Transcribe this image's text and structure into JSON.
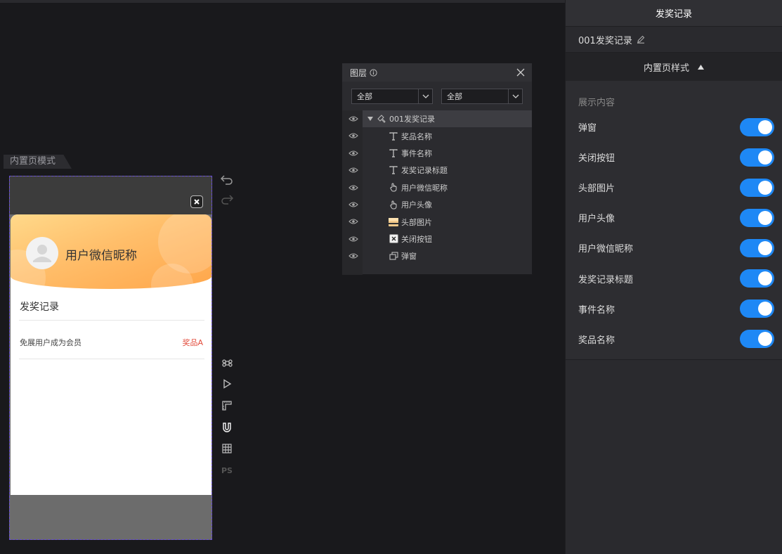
{
  "canvas": {
    "mode_tab": "内置页模式",
    "preview": {
      "nickname": "用户微信昵称",
      "record_title": "发奖记录",
      "event_name": "免展用户成为会员",
      "prize_name": "奖品A"
    },
    "tools": {
      "ps_label": "PS"
    }
  },
  "layers_panel": {
    "title": "图层",
    "filter1": "全部",
    "filter2": "全部",
    "items": [
      {
        "label": "001发奖记录",
        "icon": "component-icon"
      },
      {
        "label": "奖品名称",
        "icon": "text-icon"
      },
      {
        "label": "事件名称",
        "icon": "text-icon"
      },
      {
        "label": "发奖记录标题",
        "icon": "text-icon"
      },
      {
        "label": "用户微信昵称",
        "icon": "hand-icon"
      },
      {
        "label": "用户头像",
        "icon": "hand-icon"
      },
      {
        "label": "头部图片",
        "icon": "image-icon"
      },
      {
        "label": "关闭按钮",
        "icon": "close-box-icon"
      },
      {
        "label": "弹窗",
        "icon": "popup-icon"
      }
    ]
  },
  "right_panel": {
    "title": "发奖记录",
    "component_name": "001发奖记录",
    "section_title": "内置页样式",
    "subsection": "展示内容",
    "toggles": [
      {
        "label": "弹窗",
        "on": true
      },
      {
        "label": "关闭按钮",
        "on": true
      },
      {
        "label": "头部图片",
        "on": true
      },
      {
        "label": "用户头像",
        "on": true
      },
      {
        "label": "用户微信昵称",
        "on": true
      },
      {
        "label": "发奖记录标题",
        "on": true
      },
      {
        "label": "事件名称",
        "on": true
      },
      {
        "label": "奖品名称",
        "on": true
      }
    ]
  },
  "colors": {
    "accent": "#1e88f5",
    "prize": "#e24b3b",
    "header_start": "#ffd98a",
    "header_end": "#ffa64a"
  }
}
